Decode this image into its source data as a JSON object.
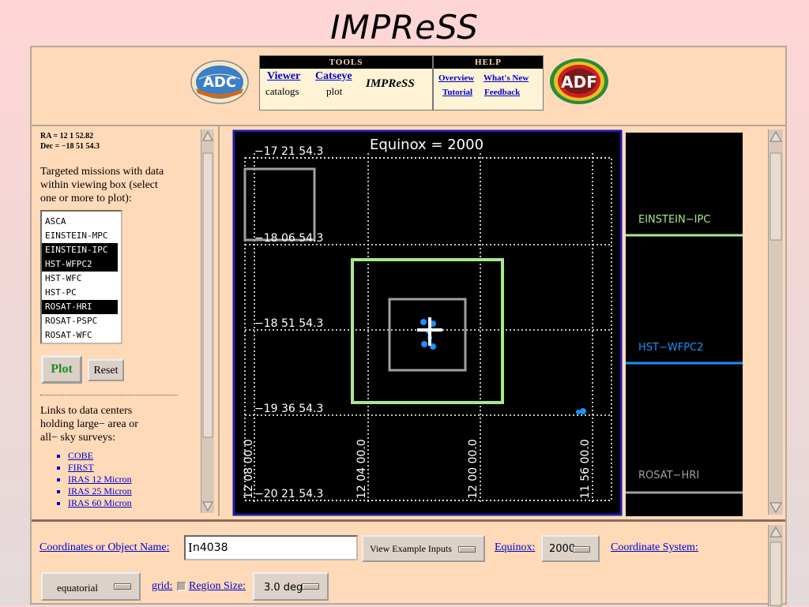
{
  "slide_title": "IMPReSS",
  "header": {
    "tools_label": "TOOLS",
    "help_label": "HELP",
    "viewer_label": "Viewer",
    "viewer_sub": "catalogs",
    "catseye_label": "Catseye",
    "catseye_sub": "plot",
    "impress_label": "IMPReSS",
    "overview_label": "Overview",
    "whats_new_label": "What's New",
    "tutorial_label": "Tutorial",
    "feedback_label": "Feedback",
    "adc_logo_text": "ADC",
    "adf_logo_text": "ADF"
  },
  "left_panel": {
    "ra": "RA = 12 1 52.82",
    "dec": "Dec = −18 51 54.3",
    "targeted_text_1": "Targeted missions with data",
    "targeted_text_2": "within viewing box (select",
    "targeted_text_3": "one or more to plot):",
    "missions": [
      {
        "label": "ASCA",
        "selected": false
      },
      {
        "label": "EINSTEIN-MPC",
        "selected": false
      },
      {
        "label": "EINSTEIN-IPC",
        "selected": true
      },
      {
        "label": "HST-WFPC2",
        "selected": true
      },
      {
        "label": "HST-WFC",
        "selected": false
      },
      {
        "label": "HST-PC",
        "selected": false
      },
      {
        "label": "ROSAT-HRI",
        "selected": true
      },
      {
        "label": "ROSAT-PSPC",
        "selected": false
      },
      {
        "label": "ROSAT-WFC",
        "selected": false
      }
    ],
    "plot_label": "Plot",
    "reset_label": "Reset",
    "links_text_1": "Links to data centers",
    "links_text_2": "holding large− area or",
    "links_text_3": "all− sky surveys:",
    "links": [
      "COBE",
      "FIRST",
      "IRAS 12 Micron",
      "IRAS 25 Micron",
      "IRAS 60 Micron"
    ]
  },
  "plot": {
    "equinox_title": "Equinox = 2000",
    "dec_labels": [
      "−17 21 54.3",
      "−18 06 54.3",
      "−18 51 54.3",
      "−19 36 54.3",
      "−20 21 54.3"
    ],
    "ra_labels": [
      "12 08 00.0",
      "12 04 00.0",
      "12 00 00.0",
      "11 56 00.0"
    ]
  },
  "legend": {
    "items": [
      {
        "label": "EINSTEIN−IPC",
        "color": "#a8e890"
      },
      {
        "label": "HST−WFPC2",
        "color": "#1e90ff"
      },
      {
        "label": "ROSAT−HRI",
        "color": "#a0a0a0"
      }
    ]
  },
  "bottom": {
    "coords_label": "Coordinates or Object Name:",
    "coords_value": "n4038",
    "view_example_label": "View Example Inputs",
    "equinox_label": "Equinox:",
    "equinox_value": "2000",
    "coord_system_label": "Coordinate System:",
    "coord_system_value": "equatorial",
    "grid_label": "grid:",
    "region_size_label": "Region Size:",
    "region_size_value": "3.0 deg"
  },
  "colors": {
    "background_peach": "#ffdab9",
    "plot_bg": "#000000",
    "plot_border": "#1a1aa8",
    "einstein_ipc": "#a8e890",
    "hst_wfpc2": "#1e90ff",
    "rosat_hri": "#a0a0a0",
    "link_blue": "#0000cc"
  }
}
